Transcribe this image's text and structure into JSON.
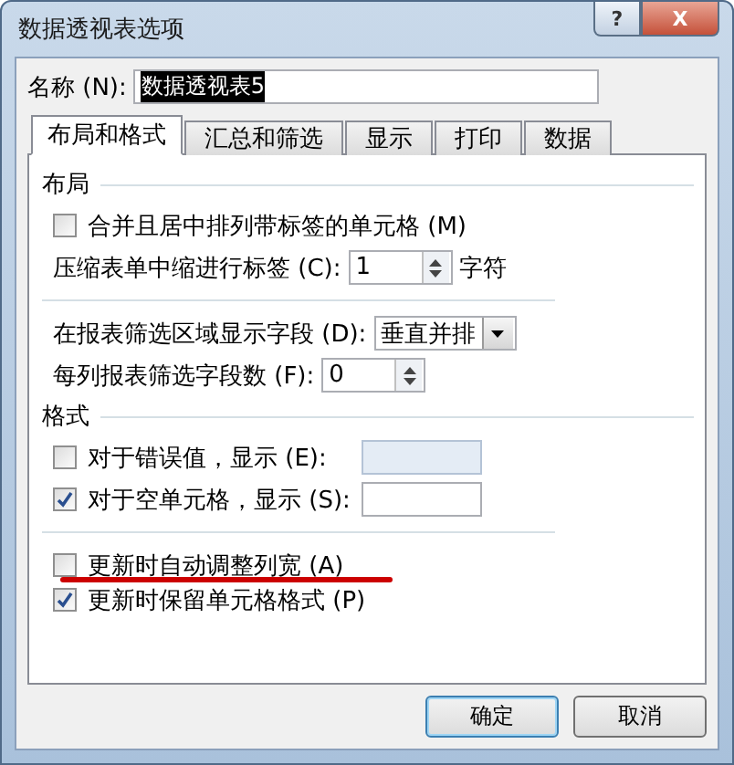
{
  "window": {
    "title": "数据透视表选项",
    "buttons": [
      {
        "kind": "help",
        "label": "?"
      },
      {
        "kind": "close",
        "label": "X"
      }
    ]
  },
  "name_field": {
    "label": "名称 (N):",
    "value": "数据透视表5",
    "value_selected": true
  },
  "tabs": [
    {
      "label": "布局和格式",
      "selected": true
    },
    {
      "label": "汇总和筛选",
      "selected": false
    },
    {
      "label": "显示",
      "selected": false
    },
    {
      "label": "打印",
      "selected": false
    },
    {
      "label": "数据",
      "selected": false
    }
  ],
  "sections": [
    {
      "title": "布局",
      "items": [
        {
          "kind": "checkbox",
          "label": "合并且居中排列带标签的单元格 (M)",
          "checked": false
        },
        {
          "kind": "spinner",
          "label": "压缩表单中缩进行标签 (C):",
          "value": "1",
          "suffix": "字符"
        },
        {
          "kind": "divider"
        },
        {
          "kind": "select",
          "label": "在报表筛选区域显示字段 (D):",
          "value": "垂直并排"
        },
        {
          "kind": "spinner",
          "label": "每列报表筛选字段数 (F):",
          "value": "0"
        }
      ]
    },
    {
      "title": "格式",
      "items": [
        {
          "kind": "checkbox_field",
          "label": "对于错误值，显示 (E):",
          "checked": false
        },
        {
          "kind": "checkbox_field",
          "label": "对于空单元格，显示 (S):",
          "checked": true
        },
        {
          "kind": "divider"
        },
        {
          "kind": "checkbox",
          "label": "更新时自动调整列宽 (A)",
          "checked": false,
          "underlined": true
        },
        {
          "kind": "checkbox",
          "label": "更新时保留单元格格式 (P)",
          "checked": true
        }
      ]
    }
  ],
  "buttons": [
    {
      "label": "确定",
      "default": true
    },
    {
      "label": "取消",
      "default": false
    }
  ]
}
